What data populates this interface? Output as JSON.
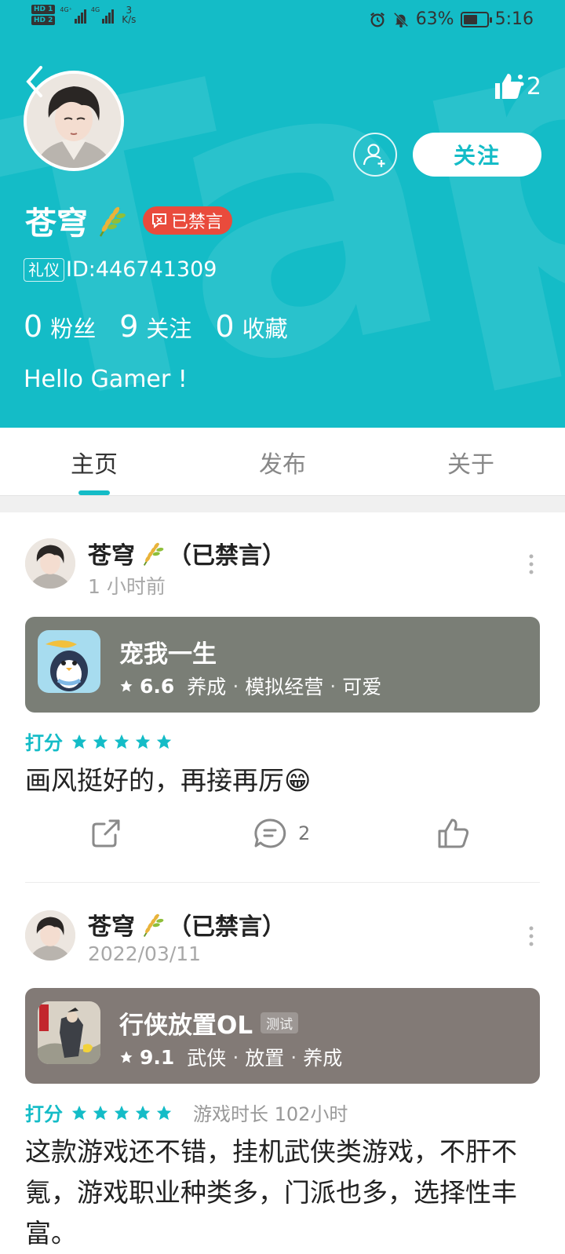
{
  "status_bar": {
    "hd1": "HD 1",
    "hd2": "HD 2",
    "net1": "4G⁺",
    "net2": "4G",
    "speed_value": "3",
    "speed_unit": "K/s",
    "battery_pct": "63%",
    "battery_level": 0.63,
    "time": "5:16"
  },
  "profile": {
    "name": "苍穹",
    "muted_badge": "已禁言",
    "id_tag": "礼仪",
    "id_text": "ID:446741309",
    "likes": "2",
    "follow_label": "关注",
    "stats": [
      {
        "num": "0",
        "label": "粉丝"
      },
      {
        "num": "9",
        "label": "关注"
      },
      {
        "num": "0",
        "label": "收藏"
      }
    ],
    "bio": "Hello Gamer !"
  },
  "tabs": [
    {
      "label": "主页",
      "active": true
    },
    {
      "label": "发布",
      "active": false
    },
    {
      "label": "关于",
      "active": false
    }
  ],
  "posts": [
    {
      "author": "苍穹",
      "author_suffix": "（已禁言）",
      "time": "1 小时前",
      "game": {
        "title": "宠我一生",
        "tag": "",
        "score": "6.6",
        "tags": [
          "养成",
          "模拟经营",
          "可爱"
        ],
        "bg": "#7a7e76"
      },
      "rating_label": "打分",
      "stars": 5,
      "play_time": "",
      "review": "画风挺好的，再接再厉😁",
      "comments": "2"
    },
    {
      "author": "苍穹",
      "author_suffix": "（已禁言）",
      "time": "2022/03/11",
      "game": {
        "title": "行侠放置OL",
        "tag": "测试",
        "score": "9.1",
        "tags": [
          "武侠",
          "放置",
          "养成"
        ],
        "bg": "#827a76"
      },
      "rating_label": "打分",
      "stars": 5,
      "play_time": "游戏时长 102小时",
      "review": "这款游戏还不错，挂机武侠类游戏，不肝不氪，游戏职业种类多，门派也多，选择性丰富。",
      "comments": ""
    }
  ],
  "colors": {
    "accent": "#14bcc7",
    "muted_red": "#e94b3c"
  }
}
